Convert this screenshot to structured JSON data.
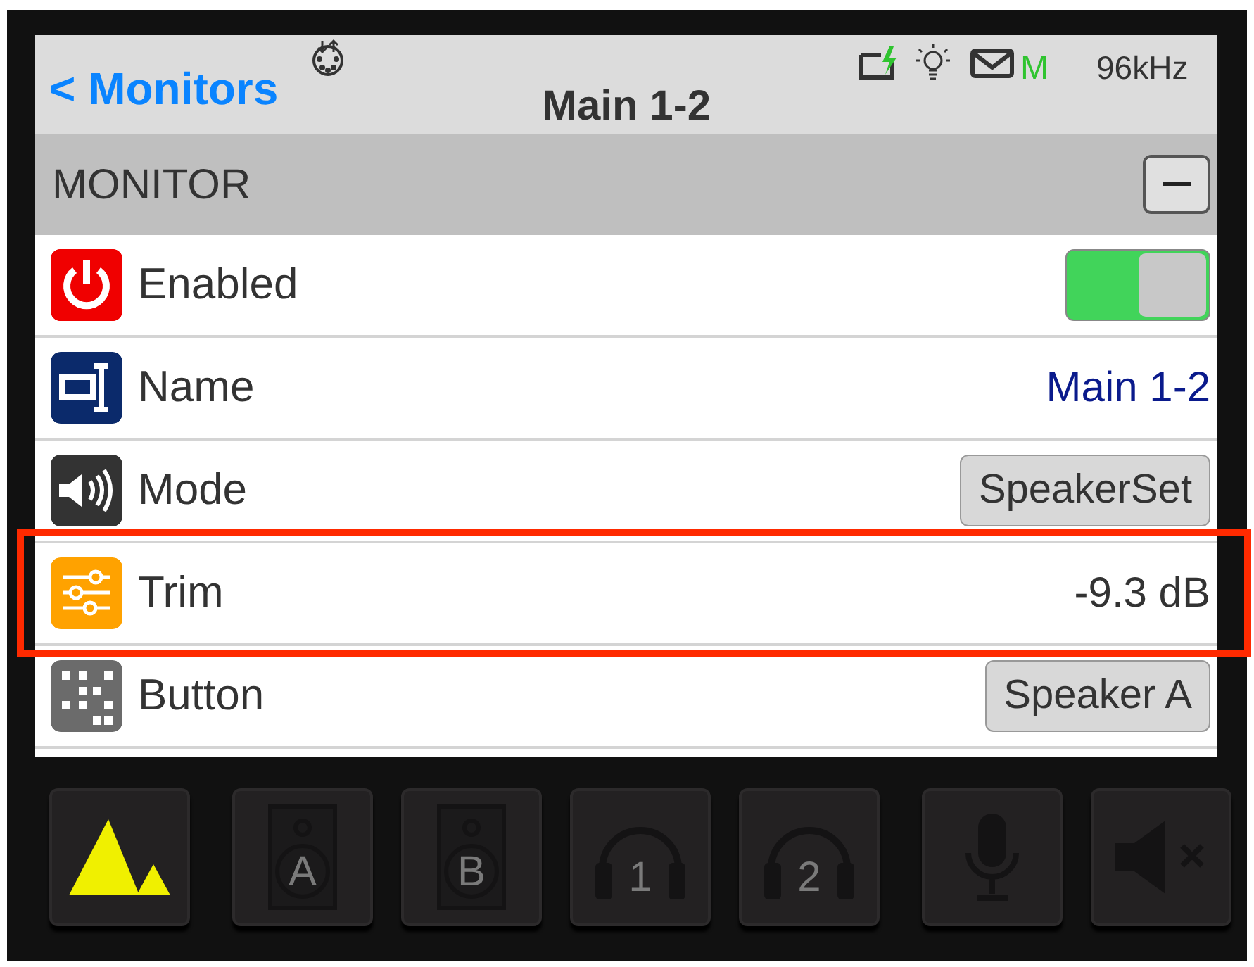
{
  "header": {
    "back": "< Monitors",
    "title": "Main 1-2",
    "status_m": "M",
    "sample_rate": "96kHz"
  },
  "section": {
    "title": "MONITOR",
    "expanded": true
  },
  "rows": [
    {
      "kind": "toggle",
      "label": "Enabled",
      "on": true,
      "highlighted": false
    },
    {
      "kind": "text",
      "label": "Name",
      "value": "Main 1-2",
      "highlighted": false
    },
    {
      "kind": "button",
      "label": "Mode",
      "value": "SpeakerSet",
      "highlighted": false
    },
    {
      "kind": "text",
      "label": "Trim",
      "value": "-9.3 dB",
      "highlighted": true
    },
    {
      "kind": "button",
      "label": "Button",
      "value": "Speaker A",
      "highlighted": false
    }
  ],
  "bottom_bar": [
    [
      {
        "kind": "logo",
        "active": true
      }
    ],
    [
      {
        "kind": "speaker",
        "label": "A",
        "active": false
      },
      {
        "kind": "speaker",
        "label": "B",
        "active": false
      },
      {
        "kind": "headphones",
        "label": "1",
        "active": false
      },
      {
        "kind": "headphones",
        "label": "2",
        "active": false
      }
    ],
    [
      {
        "kind": "mic",
        "active": false
      },
      {
        "kind": "mute",
        "active": false
      }
    ]
  ]
}
